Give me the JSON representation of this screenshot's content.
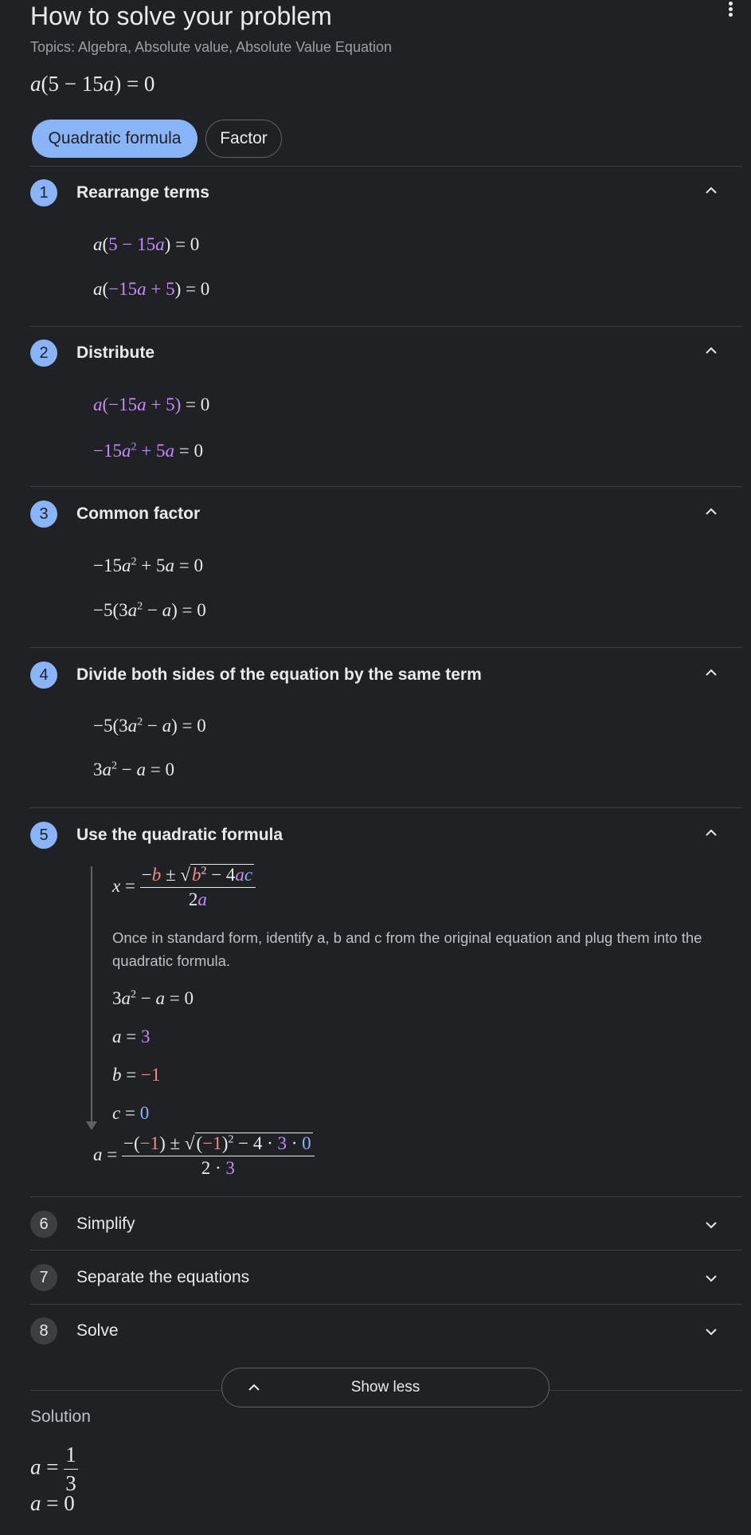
{
  "header": {
    "title": "How to solve your problem",
    "topics": "Topics: Algebra, Absolute value, Absolute Value Equation"
  },
  "chips": {
    "active": "Quadratic formula",
    "inactive": "Factor"
  },
  "steps": [
    {
      "num": "1",
      "title": "Rearrange terms"
    },
    {
      "num": "2",
      "title": "Distribute"
    },
    {
      "num": "3",
      "title": "Common factor"
    },
    {
      "num": "4",
      "title": "Divide both sides of the equation by the same term"
    },
    {
      "num": "5",
      "title": "Use the quadratic formula",
      "description": "Once in standard form, identify a, b and c from the original equation and plug them into the quadratic formula."
    },
    {
      "num": "6",
      "title": "Simplify"
    },
    {
      "num": "7",
      "title": "Separate the equations"
    },
    {
      "num": "8",
      "title": "Solve"
    }
  ],
  "show_less": "Show less",
  "solution": {
    "label": "Solution"
  },
  "colors": {
    "accent": "#8ab4f8",
    "purple": "#c58af9",
    "red": "#f28b82",
    "background": "#202124"
  },
  "icons": [
    "more-vert-icon",
    "chevron-up-icon",
    "chevron-down-icon"
  ]
}
